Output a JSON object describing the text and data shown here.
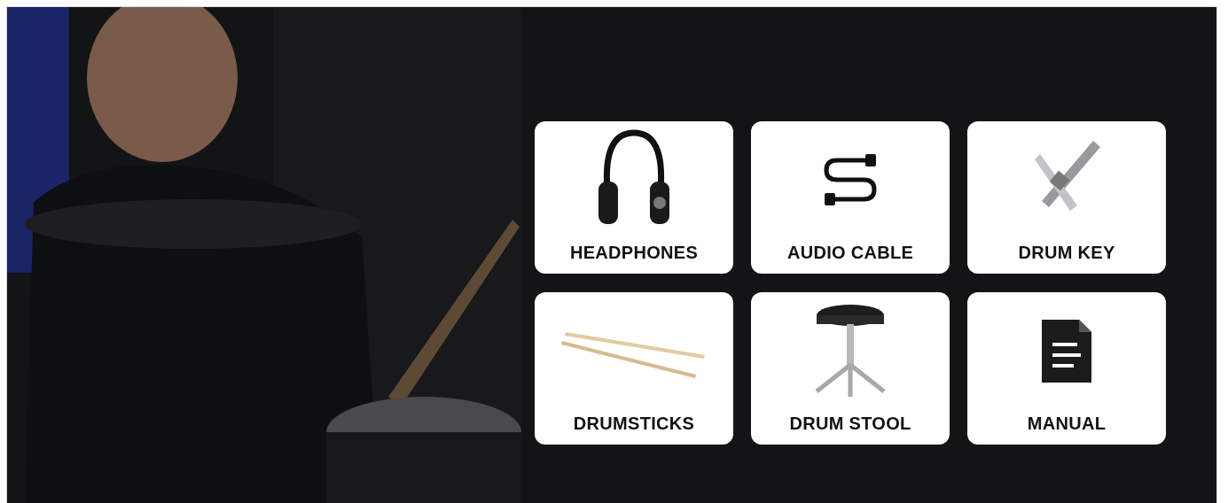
{
  "cards": [
    {
      "label": "HEADPHONES"
    },
    {
      "label": "AUDIO CABLE"
    },
    {
      "label": "DRUM KEY"
    },
    {
      "label": "DRUMSTICKS"
    },
    {
      "label": "DRUM STOOL"
    },
    {
      "label": "MANUAL"
    }
  ]
}
